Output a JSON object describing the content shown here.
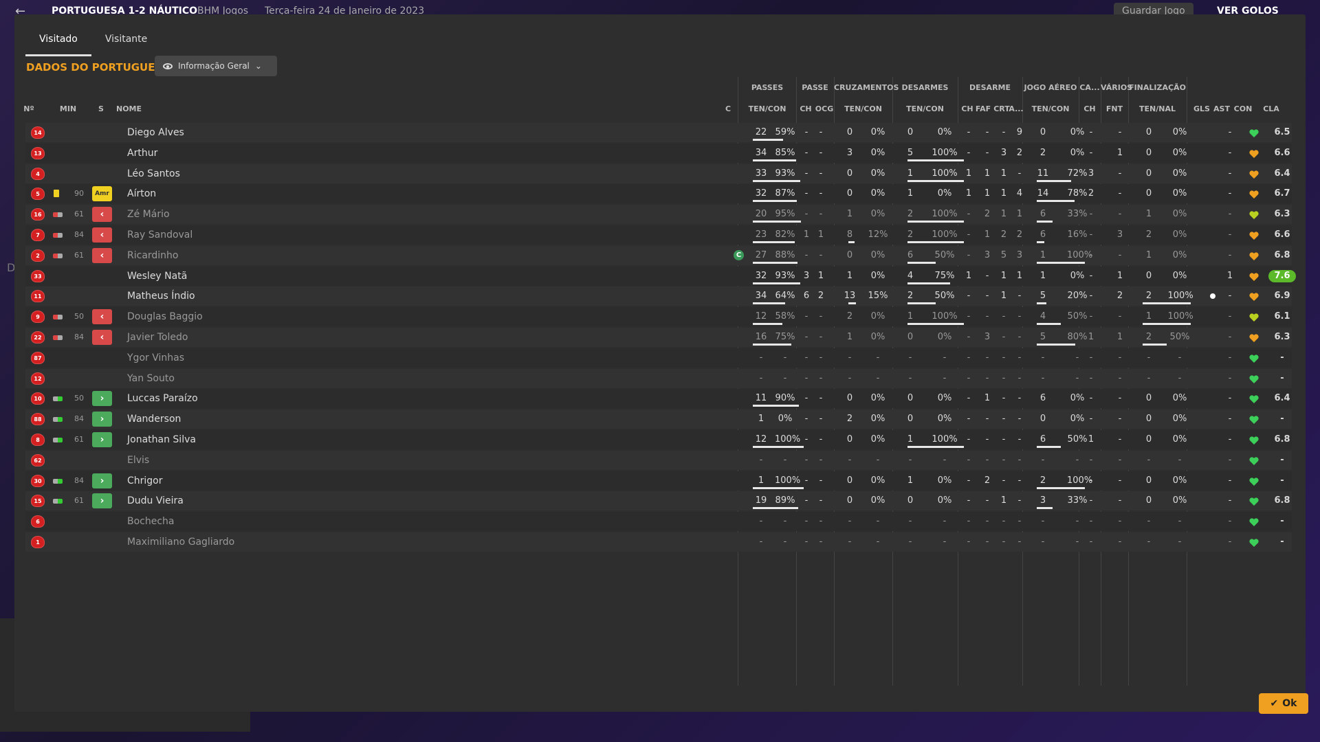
{
  "topbar": {
    "match": "PORTUGUESA 1-2 NÁUTICO",
    "competition": "BHM Jogos",
    "date": "Terça-feira 24 de Janeiro de 2023",
    "save": "Guardar Jogo",
    "goals": "VER GOLOS"
  },
  "tabs": [
    "Visitado",
    "Visitante"
  ],
  "team_title": "DADOS DO PORTUGUESA",
  "view_select": "Informação Geral",
  "group_headers": [
    "PASSES",
    "PASSE",
    "CRUZAMENTOS",
    "DESARMES",
    "DESARME",
    "JOGO AÉREO",
    "CA...",
    "VÁRIOS",
    "FINALIZAÇÃO"
  ],
  "col_headers": [
    "Nº",
    "MIN",
    "S",
    "NOME",
    "C",
    "TEN/CON",
    "CH",
    "OCG",
    "TEN/CON",
    "TEN/CON",
    "CH",
    "FAF",
    "CRT",
    "A...",
    "TEN/CON",
    "CH",
    "FNT",
    "TEN/NAL",
    "GLS",
    "AST",
    "CON",
    "CLA"
  ],
  "players": [
    {
      "num": "14",
      "min": "",
      "s": "",
      "name": "Diego Alves",
      "c": "",
      "p1": "22",
      "p2": "59%",
      "ch": "-",
      "ocg": "-",
      "cr1": "0",
      "cr2": "0%",
      "d1": "0",
      "d2": "0%",
      "dch": "-",
      "faf": "-",
      "crt": "-",
      "a": "9",
      "ja1": "0",
      "ja2": "0%",
      "ca": "-",
      "fnt": "-",
      "f1": "0",
      "f2": "0%",
      "gls": "",
      "ast": "-",
      "cla": "6.5",
      "active": true,
      "pbar": 0.59,
      "dbar": 0,
      "jbar": 0,
      "fbar": 0,
      "heart": "green"
    },
    {
      "num": "13",
      "min": "",
      "s": "",
      "name": "Arthur",
      "c": "",
      "p1": "34",
      "p2": "85%",
      "ch": "-",
      "ocg": "-",
      "cr1": "3",
      "cr2": "0%",
      "d1": "5",
      "d2": "100%",
      "dch": "-",
      "faf": "-",
      "crt": "3",
      "a": "2",
      "ja1": "2",
      "ja2": "0%",
      "ca": "-",
      "fnt": "1",
      "f1": "0",
      "f2": "0%",
      "gls": "",
      "ast": "-",
      "cla": "6.6",
      "active": true,
      "pbar": 0.85,
      "dbar": 1,
      "jbar": 0,
      "fbar": 0,
      "heart": "orange"
    },
    {
      "num": "4",
      "min": "",
      "s": "",
      "name": "Léo Santos",
      "c": "",
      "p1": "33",
      "p2": "93%",
      "ch": "-",
      "ocg": "-",
      "cr1": "0",
      "cr2": "0%",
      "d1": "1",
      "d2": "100%",
      "dch": "1",
      "faf": "1",
      "crt": "1",
      "a": "-",
      "ja1": "11",
      "ja2": "72%",
      "ca": "3",
      "fnt": "-",
      "f1": "0",
      "f2": "0%",
      "gls": "",
      "ast": "-",
      "cla": "6.4",
      "active": true,
      "pbar": 0.93,
      "dbar": 1,
      "jbar": 0.72,
      "fbar": 0,
      "heart": "orange"
    },
    {
      "num": "5",
      "min": "90",
      "s": "Amr",
      "name": "Aírton",
      "c": "",
      "p1": "32",
      "p2": "87%",
      "ch": "-",
      "ocg": "-",
      "cr1": "0",
      "cr2": "0%",
      "d1": "1",
      "d2": "0%",
      "dch": "1",
      "faf": "1",
      "crt": "1",
      "a": "4",
      "ja1": "14",
      "ja2": "78%",
      "ca": "2",
      "fnt": "-",
      "f1": "0",
      "f2": "0%",
      "gls": "",
      "ast": "-",
      "cla": "6.7",
      "active": true,
      "pbar": 0.87,
      "dbar": 0,
      "jbar": 0.78,
      "fbar": 0,
      "heart": "orange",
      "yellow": true
    },
    {
      "num": "16",
      "min": "61",
      "s": "out",
      "name": "Zé Mário",
      "c": "",
      "p1": "20",
      "p2": "95%",
      "ch": "-",
      "ocg": "-",
      "cr1": "1",
      "cr2": "0%",
      "d1": "2",
      "d2": "100%",
      "dch": "-",
      "faf": "2",
      "crt": "1",
      "a": "1",
      "ja1": "6",
      "ja2": "33%",
      "ca": "-",
      "fnt": "-",
      "f1": "1",
      "f2": "0%",
      "gls": "",
      "ast": "-",
      "cla": "6.3",
      "active": false,
      "pbar": 0.95,
      "dbar": 1,
      "jbar": 0.33,
      "fbar": 0,
      "heart": "yellowgreen"
    },
    {
      "num": "7",
      "min": "84",
      "s": "out",
      "name": "Ray Sandoval",
      "c": "",
      "p1": "23",
      "p2": "82%",
      "ch": "1",
      "ocg": "1",
      "cr1": "8",
      "cr2": "12%",
      "d1": "2",
      "d2": "100%",
      "dch": "-",
      "faf": "1",
      "crt": "2",
      "a": "2",
      "ja1": "6",
      "ja2": "16%",
      "ca": "-",
      "fnt": "3",
      "f1": "2",
      "f2": "0%",
      "gls": "",
      "ast": "-",
      "cla": "6.6",
      "active": false,
      "pbar": 0.82,
      "dbar": 1,
      "jbar": 0.16,
      "fbar": 0,
      "cbar": 0.12,
      "heart": "orange"
    },
    {
      "num": "2",
      "min": "61",
      "s": "out",
      "name": "Ricardinho",
      "c": "C",
      "p1": "27",
      "p2": "88%",
      "ch": "-",
      "ocg": "-",
      "cr1": "0",
      "cr2": "0%",
      "d1": "6",
      "d2": "50%",
      "dch": "-",
      "faf": "3",
      "crt": "5",
      "a": "3",
      "ja1": "1",
      "ja2": "100%",
      "ca": "-",
      "fnt": "-",
      "f1": "1",
      "f2": "0%",
      "gls": "",
      "ast": "-",
      "cla": "6.8",
      "active": false,
      "pbar": 0.88,
      "dbar": 0.5,
      "jbar": 1,
      "fbar": 0,
      "heart": "orange"
    },
    {
      "num": "33",
      "min": "",
      "s": "",
      "name": "Wesley Natã",
      "c": "",
      "p1": "32",
      "p2": "93%",
      "ch": "3",
      "ocg": "1",
      "cr1": "1",
      "cr2": "0%",
      "d1": "4",
      "d2": "75%",
      "dch": "1",
      "faf": "-",
      "crt": "1",
      "a": "1",
      "ja1": "1",
      "ja2": "0%",
      "ca": "-",
      "fnt": "1",
      "f1": "0",
      "f2": "0%",
      "gls": "",
      "ast": "1",
      "cla": "7.6",
      "active": true,
      "pbar": 0.93,
      "dbar": 0.75,
      "jbar": 0,
      "fbar": 0,
      "heart": "orange",
      "best": true
    },
    {
      "num": "11",
      "min": "",
      "s": "",
      "name": "Matheus Índio",
      "c": "",
      "p1": "34",
      "p2": "64%",
      "ch": "6",
      "ocg": "2",
      "cr1": "13",
      "cr2": "15%",
      "d1": "2",
      "d2": "50%",
      "dch": "-",
      "faf": "-",
      "crt": "1",
      "a": "-",
      "ja1": "5",
      "ja2": "20%",
      "ca": "-",
      "fnt": "2",
      "f1": "2",
      "f2": "100%",
      "gls": "ball",
      "ast": "-",
      "cla": "6.9",
      "active": true,
      "pbar": 0.64,
      "dbar": 0.5,
      "jbar": 0.2,
      "fbar": 1,
      "cbar": 0.15,
      "heart": "orange"
    },
    {
      "num": "9",
      "min": "50",
      "s": "out",
      "name": "Douglas Baggio",
      "c": "",
      "p1": "12",
      "p2": "58%",
      "ch": "-",
      "ocg": "-",
      "cr1": "2",
      "cr2": "0%",
      "d1": "1",
      "d2": "100%",
      "dch": "-",
      "faf": "-",
      "crt": "-",
      "a": "-",
      "ja1": "4",
      "ja2": "50%",
      "ca": "-",
      "fnt": "-",
      "f1": "1",
      "f2": "100%",
      "gls": "",
      "ast": "-",
      "cla": "6.1",
      "active": false,
      "pbar": 0.58,
      "dbar": 1,
      "jbar": 0.5,
      "fbar": 1,
      "heart": "yellowgreen"
    },
    {
      "num": "22",
      "min": "84",
      "s": "out",
      "name": "Javier Toledo",
      "c": "",
      "p1": "16",
      "p2": "75%",
      "ch": "-",
      "ocg": "-",
      "cr1": "1",
      "cr2": "0%",
      "d1": "0",
      "d2": "0%",
      "dch": "-",
      "faf": "3",
      "crt": "-",
      "a": "-",
      "ja1": "5",
      "ja2": "80%",
      "ca": "1",
      "fnt": "1",
      "f1": "2",
      "f2": "50%",
      "gls": "",
      "ast": "-",
      "cla": "6.3",
      "active": false,
      "pbar": 0.75,
      "dbar": 0,
      "jbar": 0.8,
      "fbar": 0.5,
      "heart": "orange"
    },
    {
      "num": "87",
      "min": "",
      "s": "",
      "name": "Ygor Vinhas",
      "c": "",
      "p1": "-",
      "p2": "-",
      "ch": "-",
      "ocg": "-",
      "cr1": "-",
      "cr2": "-",
      "d1": "-",
      "d2": "-",
      "dch": "-",
      "faf": "-",
      "crt": "-",
      "a": "-",
      "ja1": "-",
      "ja2": "-",
      "ca": "-",
      "fnt": "-",
      "f1": "-",
      "f2": "-",
      "gls": "",
      "ast": "-",
      "cla": "-",
      "active": false,
      "pbar": 0,
      "dbar": 0,
      "jbar": 0,
      "fbar": 0,
      "heart": "green"
    },
    {
      "num": "12",
      "min": "",
      "s": "",
      "name": "Yan Souto",
      "c": "",
      "p1": "-",
      "p2": "-",
      "ch": "-",
      "ocg": "-",
      "cr1": "-",
      "cr2": "-",
      "d1": "-",
      "d2": "-",
      "dch": "-",
      "faf": "-",
      "crt": "-",
      "a": "-",
      "ja1": "-",
      "ja2": "-",
      "ca": "-",
      "fnt": "-",
      "f1": "-",
      "f2": "-",
      "gls": "",
      "ast": "-",
      "cla": "-",
      "active": false,
      "pbar": 0,
      "dbar": 0,
      "jbar": 0,
      "fbar": 0,
      "heart": "green"
    },
    {
      "num": "10",
      "min": "50",
      "s": "in",
      "name": "Luccas Paraízo",
      "c": "",
      "p1": "11",
      "p2": "90%",
      "ch": "-",
      "ocg": "-",
      "cr1": "0",
      "cr2": "0%",
      "d1": "0",
      "d2": "0%",
      "dch": "-",
      "faf": "1",
      "crt": "-",
      "a": "-",
      "ja1": "6",
      "ja2": "0%",
      "ca": "-",
      "fnt": "-",
      "f1": "0",
      "f2": "0%",
      "gls": "",
      "ast": "-",
      "cla": "6.4",
      "active": true,
      "pbar": 0.9,
      "dbar": 0,
      "jbar": 0,
      "fbar": 0,
      "heart": "green"
    },
    {
      "num": "88",
      "min": "84",
      "s": "in",
      "name": "Wanderson",
      "c": "",
      "p1": "1",
      "p2": "0%",
      "ch": "-",
      "ocg": "-",
      "cr1": "2",
      "cr2": "0%",
      "d1": "0",
      "d2": "0%",
      "dch": "-",
      "faf": "-",
      "crt": "-",
      "a": "-",
      "ja1": "0",
      "ja2": "0%",
      "ca": "-",
      "fnt": "-",
      "f1": "0",
      "f2": "0%",
      "gls": "",
      "ast": "-",
      "cla": "-",
      "active": true,
      "pbar": 0,
      "dbar": 0,
      "jbar": 0,
      "fbar": 0,
      "heart": "green"
    },
    {
      "num": "8",
      "min": "61",
      "s": "in",
      "name": "Jonathan Silva",
      "c": "",
      "p1": "12",
      "p2": "100%",
      "ch": "-",
      "ocg": "-",
      "cr1": "0",
      "cr2": "0%",
      "d1": "1",
      "d2": "100%",
      "dch": "-",
      "faf": "-",
      "crt": "-",
      "a": "-",
      "ja1": "6",
      "ja2": "50%",
      "ca": "1",
      "fnt": "-",
      "f1": "0",
      "f2": "0%",
      "gls": "",
      "ast": "-",
      "cla": "6.8",
      "active": true,
      "pbar": 1,
      "dbar": 1,
      "jbar": 0.5,
      "fbar": 0,
      "heart": "green"
    },
    {
      "num": "62",
      "min": "",
      "s": "",
      "name": "Elvis",
      "c": "",
      "p1": "-",
      "p2": "-",
      "ch": "-",
      "ocg": "-",
      "cr1": "-",
      "cr2": "-",
      "d1": "-",
      "d2": "-",
      "dch": "-",
      "faf": "-",
      "crt": "-",
      "a": "-",
      "ja1": "-",
      "ja2": "-",
      "ca": "-",
      "fnt": "-",
      "f1": "-",
      "f2": "-",
      "gls": "",
      "ast": "-",
      "cla": "-",
      "active": false,
      "pbar": 0,
      "dbar": 0,
      "jbar": 0,
      "fbar": 0,
      "heart": "green"
    },
    {
      "num": "30",
      "min": "84",
      "s": "in",
      "name": "Chrigor",
      "c": "",
      "p1": "1",
      "p2": "100%",
      "ch": "-",
      "ocg": "-",
      "cr1": "0",
      "cr2": "0%",
      "d1": "1",
      "d2": "0%",
      "dch": "-",
      "faf": "2",
      "crt": "-",
      "a": "-",
      "ja1": "2",
      "ja2": "100%",
      "ca": "-",
      "fnt": "-",
      "f1": "0",
      "f2": "0%",
      "gls": "",
      "ast": "-",
      "cla": "-",
      "active": true,
      "pbar": 1,
      "dbar": 0,
      "jbar": 1,
      "fbar": 0,
      "heart": "green"
    },
    {
      "num": "15",
      "min": "61",
      "s": "in",
      "name": "Dudu Vieira",
      "c": "",
      "p1": "19",
      "p2": "89%",
      "ch": "-",
      "ocg": "-",
      "cr1": "0",
      "cr2": "0%",
      "d1": "0",
      "d2": "0%",
      "dch": "-",
      "faf": "-",
      "crt": "1",
      "a": "-",
      "ja1": "3",
      "ja2": "33%",
      "ca": "-",
      "fnt": "-",
      "f1": "0",
      "f2": "0%",
      "gls": "",
      "ast": "-",
      "cla": "6.8",
      "active": true,
      "pbar": 0.89,
      "dbar": 0,
      "jbar": 0.33,
      "fbar": 0,
      "heart": "green"
    },
    {
      "num": "6",
      "min": "",
      "s": "",
      "name": "Bochecha",
      "c": "",
      "p1": "-",
      "p2": "-",
      "ch": "-",
      "ocg": "-",
      "cr1": "-",
      "cr2": "-",
      "d1": "-",
      "d2": "-",
      "dch": "-",
      "faf": "-",
      "crt": "-",
      "a": "-",
      "ja1": "-",
      "ja2": "-",
      "ca": "-",
      "fnt": "-",
      "f1": "-",
      "f2": "-",
      "gls": "",
      "ast": "-",
      "cla": "-",
      "active": false,
      "pbar": 0,
      "dbar": 0,
      "jbar": 0,
      "fbar": 0,
      "heart": "green"
    },
    {
      "num": "1",
      "min": "",
      "s": "",
      "name": "Maximiliano Gagliardo",
      "c": "",
      "p1": "-",
      "p2": "-",
      "ch": "-",
      "ocg": "-",
      "cr1": "-",
      "cr2": "-",
      "d1": "-",
      "d2": "-",
      "dch": "-",
      "faf": "-",
      "crt": "-",
      "a": "-",
      "ja1": "-",
      "ja2": "-",
      "ca": "-",
      "fnt": "-",
      "f1": "-",
      "f2": "-",
      "gls": "",
      "ast": "-",
      "cla": "-",
      "active": false,
      "pbar": 0,
      "dbar": 0,
      "jbar": 0,
      "fbar": 0,
      "heart": "green"
    }
  ],
  "ok_label": "Ok",
  "colors": {
    "accent": "#f0a020",
    "sub_out": "#d84a4a",
    "sub_in": "#4caa5c",
    "best_rating": "#5cba2a"
  }
}
